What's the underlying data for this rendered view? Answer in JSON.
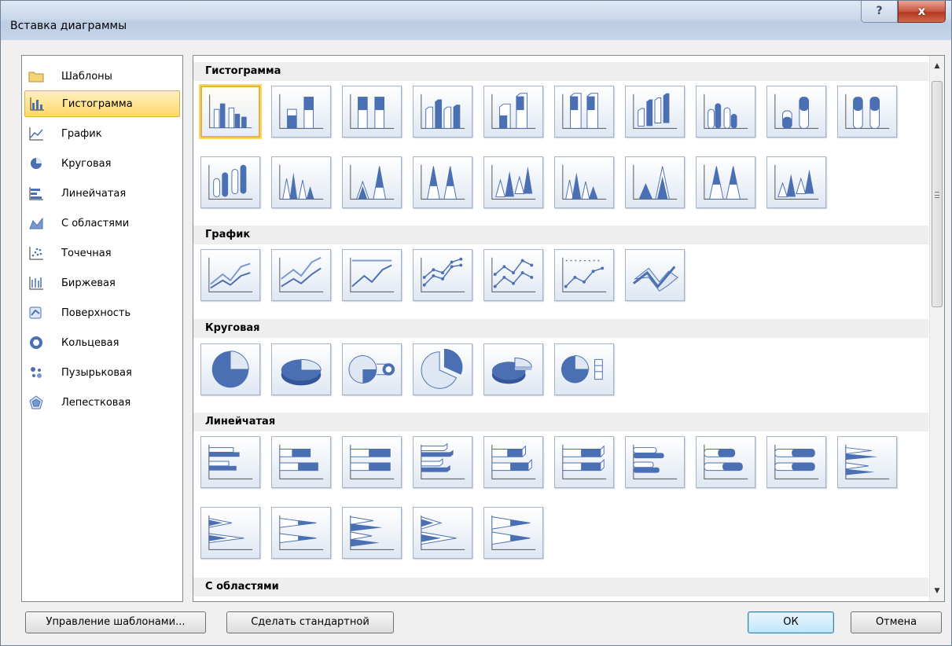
{
  "window": {
    "title": "Вставка диаграммы",
    "help_label": "?",
    "close_label": "x"
  },
  "categories": [
    {
      "label": "Шаблоны",
      "icon": "folder-icon"
    },
    {
      "label": "Гистограмма",
      "icon": "column-chart-icon",
      "selected": true
    },
    {
      "label": "График",
      "icon": "line-chart-icon"
    },
    {
      "label": "Круговая",
      "icon": "pie-chart-icon"
    },
    {
      "label": "Линейчатая",
      "icon": "bar-chart-icon"
    },
    {
      "label": "С областями",
      "icon": "area-chart-icon"
    },
    {
      "label": "Точечная",
      "icon": "scatter-chart-icon"
    },
    {
      "label": "Биржевая",
      "icon": "stock-chart-icon"
    },
    {
      "label": "Поверхность",
      "icon": "surface-chart-icon"
    },
    {
      "label": "Кольцевая",
      "icon": "doughnut-chart-icon"
    },
    {
      "label": "Пузырьковая",
      "icon": "bubble-chart-icon"
    },
    {
      "label": "Лепестковая",
      "icon": "radar-chart-icon"
    }
  ],
  "sections": {
    "histogram": {
      "title": "Гистограмма"
    },
    "line": {
      "title": "График"
    },
    "pie": {
      "title": "Круговая"
    },
    "bar": {
      "title": "Линейчатая"
    },
    "area": {
      "title": "С областями"
    }
  },
  "buttons": {
    "manage_templates": "Управление шаблонами...",
    "set_default": "Сделать стандартной",
    "ok": "ОК",
    "cancel": "Отмена"
  },
  "colors": {
    "accent_blue": "#4a6fb3",
    "selection_gold": "#e3b33b"
  }
}
